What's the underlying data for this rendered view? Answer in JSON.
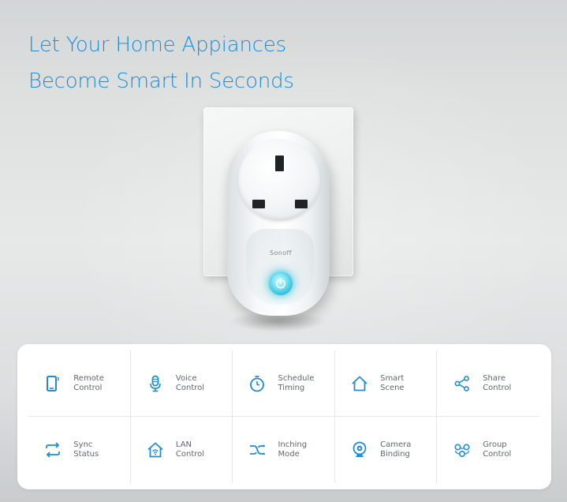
{
  "headline": {
    "line1": "Let Your Home Appiances",
    "line2": "Become Smart In Seconds"
  },
  "product": {
    "brand": "Sonoff",
    "accent_color": "#1f8dd6",
    "indicator_color": "#35c1dc"
  },
  "features": [
    {
      "icon": "phone-icon",
      "line1": "Remote",
      "line2": "Control"
    },
    {
      "icon": "microphone-icon",
      "line1": "Voice",
      "line2": "Control"
    },
    {
      "icon": "timer-icon",
      "line1": "Schedule",
      "line2": "Timing"
    },
    {
      "icon": "home-icon",
      "line1": "Smart",
      "line2": "Scene"
    },
    {
      "icon": "share-icon",
      "line1": "Share",
      "line2": "Control"
    },
    {
      "icon": "sync-icon",
      "line1": "Sync",
      "line2": "Status"
    },
    {
      "icon": "lan-home-icon",
      "line1": "LAN",
      "line2": "Control"
    },
    {
      "icon": "shuffle-icon",
      "line1": "Inching",
      "line2": "Mode"
    },
    {
      "icon": "camera-icon",
      "line1": "Camera",
      "line2": "Binding"
    },
    {
      "icon": "group-icon",
      "line1": "Group",
      "line2": "Control"
    }
  ]
}
